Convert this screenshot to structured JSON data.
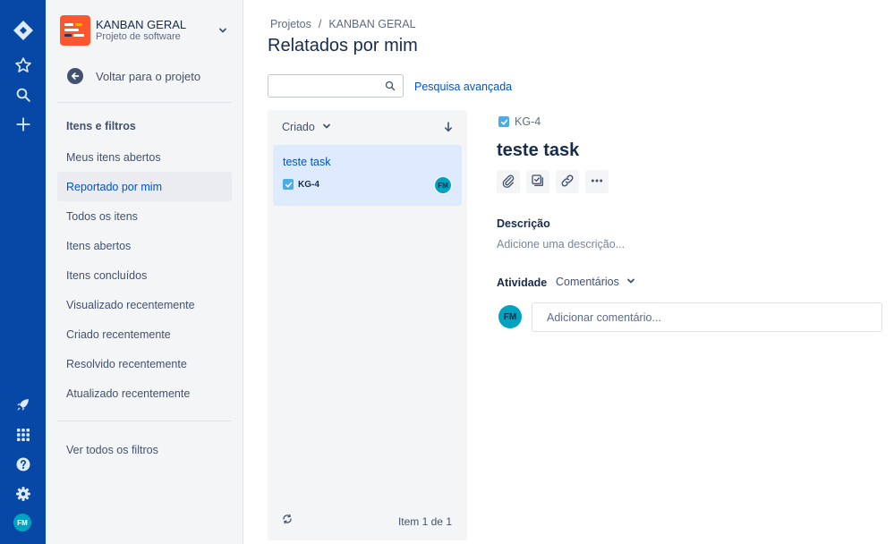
{
  "global_nav": {
    "items": [
      {
        "icon": "jira-logo-icon"
      },
      {
        "icon": "star-icon"
      },
      {
        "icon": "search-icon"
      },
      {
        "icon": "plus-icon"
      },
      {
        "icon": "rocket-icon"
      },
      {
        "icon": "app-switcher-icon"
      },
      {
        "icon": "help-icon"
      },
      {
        "icon": "settings-icon"
      }
    ],
    "user_initials": "FM"
  },
  "sidebar": {
    "project_name": "KANBAN GERAL",
    "project_type": "Projeto de software",
    "back_label": "Voltar para o projeto",
    "section_title": "Itens e filtros",
    "items": [
      {
        "label": "Meus itens abertos",
        "active": false
      },
      {
        "label": "Reportado por mim",
        "active": true
      },
      {
        "label": "Todos os itens",
        "active": false
      },
      {
        "label": "Itens abertos",
        "active": false
      },
      {
        "label": "Itens concluídos",
        "active": false
      },
      {
        "label": "Visualizado recentemente",
        "active": false
      },
      {
        "label": "Criado recentemente",
        "active": false
      },
      {
        "label": "Resolvido recentemente",
        "active": false
      },
      {
        "label": "Atualizado recentemente",
        "active": false
      }
    ],
    "all_filters_label": "Ver todos os filtros"
  },
  "breadcrumb": {
    "items": [
      "Projetos",
      "KANBAN GERAL"
    ],
    "separator": "/"
  },
  "page_title": "Relatados por mim",
  "search": {
    "value": "",
    "placeholder": "",
    "advanced_label": "Pesquisa avançada"
  },
  "list": {
    "sort_label": "Criado",
    "issues": [
      {
        "summary": "teste task",
        "key": "KG-4",
        "assignee_initials": "FM"
      }
    ],
    "pager": "Item 1 de 1"
  },
  "detail": {
    "key": "KG-4",
    "title": "teste task",
    "tools": [
      "attach-icon",
      "subtask-icon",
      "link-icon",
      "more-icon"
    ],
    "description_label": "Descrição",
    "description_placeholder": "Adicione uma descrição...",
    "activity_label": "Atividade",
    "activity_filter": "Comentários",
    "user_initials": "FM",
    "comment_placeholder": "Adicionar comentário..."
  },
  "colors": {
    "rail": "#0747a6",
    "sidebar_bg": "#f4f5f7",
    "link": "#0052cc",
    "selected_card": "#deebff",
    "avatar": "#00a3bf",
    "project_logo": "#ff5630",
    "task_icon": "#4bade8"
  }
}
